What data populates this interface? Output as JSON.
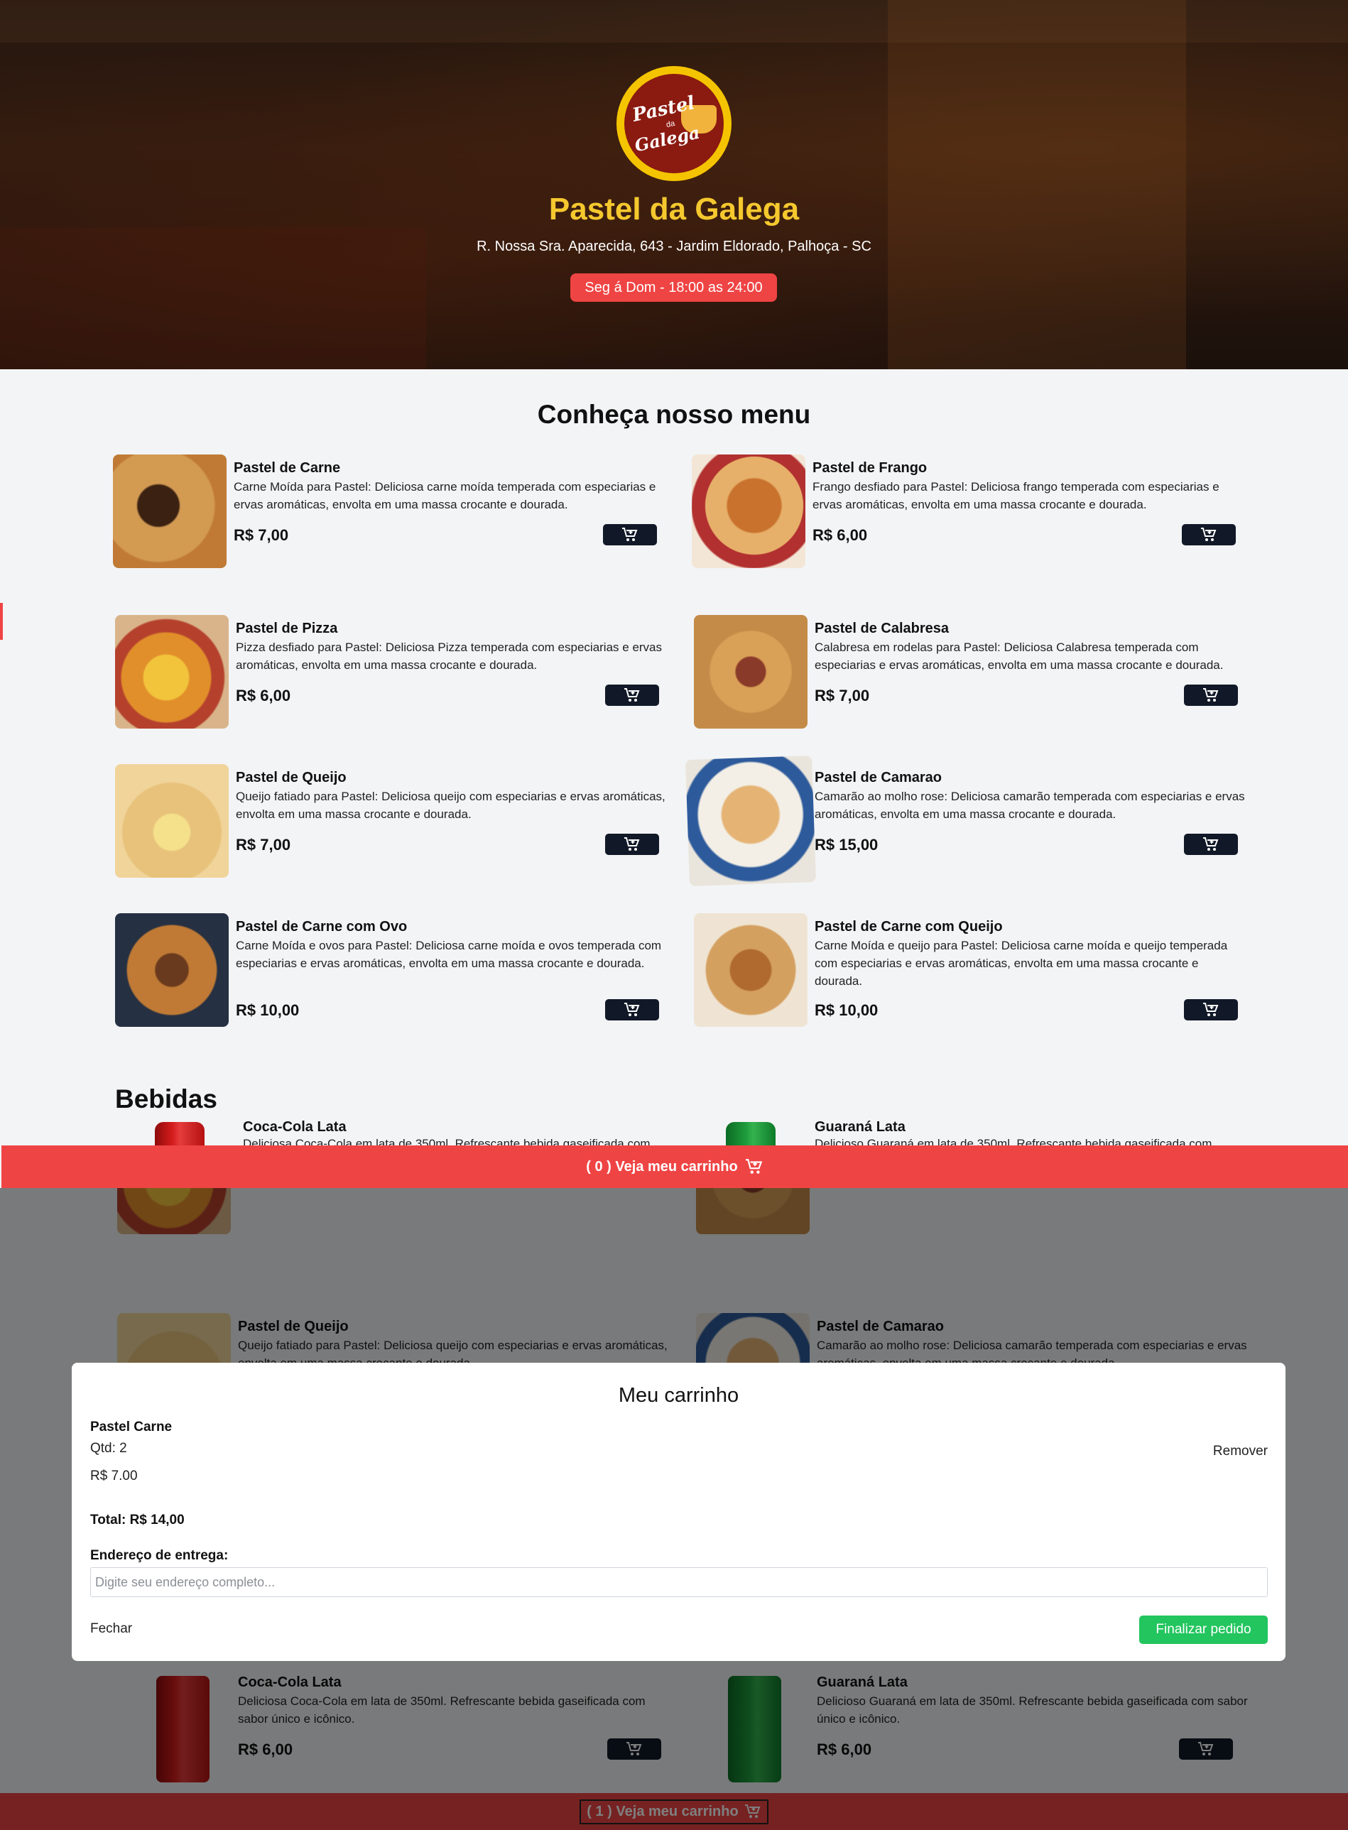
{
  "hero": {
    "logo_line1": "Pastel",
    "logo_line2": "da",
    "logo_line3": "Galega",
    "title": "Pastel da Galega",
    "address": "R. Nossa Sra. Aparecida, 643 - Jardim Eldorado, Palhoça - SC",
    "hours": "Seg á Dom - 18:00 as 24:00"
  },
  "menu": {
    "title": "Conheça nosso menu",
    "items": [
      {
        "name": "Pastel de Carne",
        "desc": "Carne Moída para Pastel: Deliciosa carne moída temperada com especiarias e ervas aromáticas, envolta em uma massa crocante e dourada.",
        "price": "R$ 7,00"
      },
      {
        "name": "Pastel de Frango",
        "desc": "Frango desfiado para Pastel: Deliciosa frango temperada com especiarias e ervas aromáticas, envolta em uma massa crocante e dourada.",
        "price": "R$ 6,00"
      },
      {
        "name": "Pastel de Pizza",
        "desc": "Pizza desfiado para Pastel: Deliciosa Pizza temperada com especiarias e ervas aromáticas, envolta em uma massa crocante e dourada.",
        "price": "R$ 6,00"
      },
      {
        "name": "Pastel de Calabresa",
        "desc": "Calabresa em rodelas para Pastel: Deliciosa Calabresa temperada com especiarias e ervas aromáticas, envolta em uma massa crocante e dourada.",
        "price": "R$ 7,00"
      },
      {
        "name": "Pastel de Queijo",
        "desc": "Queijo fatiado para Pastel: Deliciosa queijo com especiarias e ervas aromáticas, envolta em uma massa crocante e dourada.",
        "price": "R$ 7,00"
      },
      {
        "name": "Pastel de Camarao",
        "desc": "Camarão ao molho rose: Deliciosa camarão temperada com especiarias e ervas aromáticas, envolta em uma massa crocante e dourada.",
        "price": "R$ 15,00"
      },
      {
        "name": "Pastel de Carne com Ovo",
        "desc": "Carne Moída e ovos para Pastel: Deliciosa carne moída e ovos temperada com especiarias e ervas aromáticas, envolta em uma massa crocante e dourada.",
        "price": "R$ 10,00"
      },
      {
        "name": "Pastel de Carne com Queijo",
        "desc": "Carne Moída e queijo para Pastel: Deliciosa carne moída e queijo temperada com especiarias e ervas aromáticas, envolta em uma massa crocante e dourada.",
        "price": "R$ 10,00"
      }
    ]
  },
  "drinks": {
    "title": "Bebidas",
    "items": [
      {
        "name": "Coca-Cola Lata",
        "desc": "Deliciosa Coca-Cola em lata de 350ml. Refrescante bebida gaseificada com sabor único e icônico.",
        "price": "R$ 6,00"
      },
      {
        "name": "Guaraná Lata",
        "desc": "Delicioso Guaraná em lata de 350ml. Refrescante bebida gaseificada com sabor único e icônico.",
        "price": "R$ 6,00"
      }
    ]
  },
  "cart_bar": {
    "count": "0",
    "label": "Veja meu carrinho"
  },
  "cart_bar_bottom": {
    "count": "1",
    "label": "Veja meu carrinho"
  },
  "modal": {
    "title": "Meu carrinho",
    "item_name": "Pastel Carne",
    "item_qty": "Qtd: 2",
    "item_price": "R$ 7.00",
    "remove": "Remover",
    "total": "Total: R$ 14,00",
    "address_label": "Endereço de entrega:",
    "address_placeholder": "Digite seu endereço completo...",
    "close": "Fechar",
    "finish": "Finalizar pedido"
  },
  "colors": {
    "accent": "#ef4444",
    "title_yellow": "#f5c82e",
    "button_dark": "#111827",
    "finish_green": "#22c55e"
  }
}
